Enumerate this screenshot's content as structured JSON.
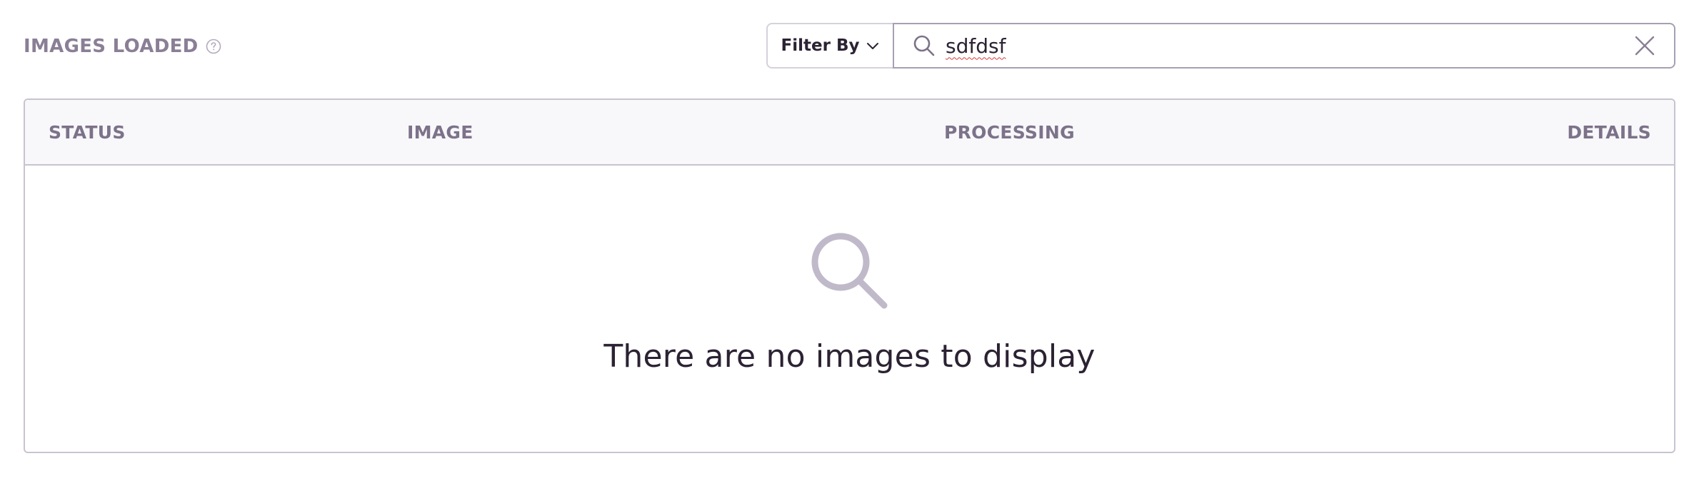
{
  "header": {
    "title": "IMAGES LOADED",
    "help_icon": "question-circle-icon"
  },
  "filter": {
    "button_label": "Filter By",
    "chevron_icon": "chevron-down-icon"
  },
  "search": {
    "value": "sdfdsf",
    "search_icon": "search-icon",
    "clear_icon": "close-icon"
  },
  "table": {
    "columns": [
      "STATUS",
      "IMAGE",
      "PROCESSING",
      "DETAILS"
    ],
    "empty_message": "There are no images to display",
    "empty_icon": "search-icon"
  },
  "colors": {
    "muted_text": "#8a7f96",
    "border": "#c9c3d1",
    "header_bg": "#f8f7fa",
    "icon_muted": "#c0b9ca",
    "text": "#2b2233"
  }
}
